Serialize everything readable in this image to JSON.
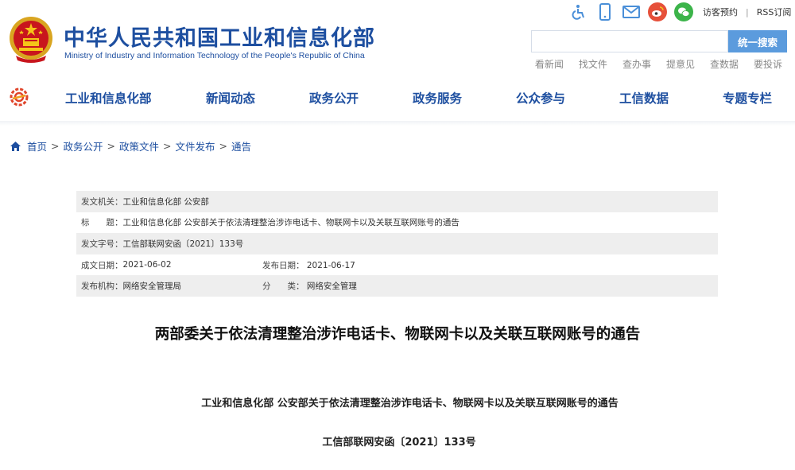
{
  "header": {
    "title": "中华人民共和国工业和信息化部",
    "subtitle": "Ministry of Industry and Information Technology of the People's Republic of China",
    "tools": {
      "icons": [
        "accessibility-icon",
        "mobile-icon",
        "mail-icon",
        "weibo-icon",
        "wechat-icon"
      ],
      "visit_label": "访客预约",
      "rss_label": "RSS订阅"
    },
    "search": {
      "placeholder": "",
      "button_label": "统一搜索"
    },
    "quick_links": [
      "看新闻",
      "找文件",
      "查办事",
      "提意见",
      "查数据",
      "要投诉"
    ]
  },
  "nav": {
    "items": [
      "工业和信息化部",
      "新闻动态",
      "政务公开",
      "政务服务",
      "公众参与",
      "工信数据",
      "专题专栏"
    ]
  },
  "breadcrumb": {
    "items": [
      "首页",
      "政务公开",
      "政策文件",
      "文件发布",
      "通告"
    ]
  },
  "meta": {
    "issuer_label": "发文机关：",
    "issuer": "工业和信息化部 公安部",
    "title_label": "标　　题：",
    "title": "工业和信息化部 公安部关于依法清理整治涉诈电话卡、物联网卡以及关联互联网账号的通告",
    "docno_label": "发文字号：",
    "docno": "工信部联网安函〔2021〕133号",
    "created_label": "成文日期：",
    "created": "2021-06-02",
    "published_label": "发布日期：",
    "published": "2021-06-17",
    "agency_label": "发布机构：",
    "agency": "网络安全管理局",
    "category_label": "分　　类：",
    "category": "网络安全管理"
  },
  "article": {
    "title": "两部委关于依法清理整治涉诈电话卡、物联网卡以及关联互联网账号的通告",
    "subtitle": "工业和信息化部 公安部关于依法清理整治涉诈电话卡、物联网卡以及关联互联网账号的通告",
    "docno": "工信部联网安函〔2021〕133号"
  },
  "colors": {
    "brand_blue": "#1e4fa0",
    "search_button": "#5b9bdd",
    "meta_shade": "#eeeeee",
    "icon_blue": "#4a8fd8",
    "weibo_red": "#e6503a",
    "wechat_green": "#3cb44a"
  }
}
